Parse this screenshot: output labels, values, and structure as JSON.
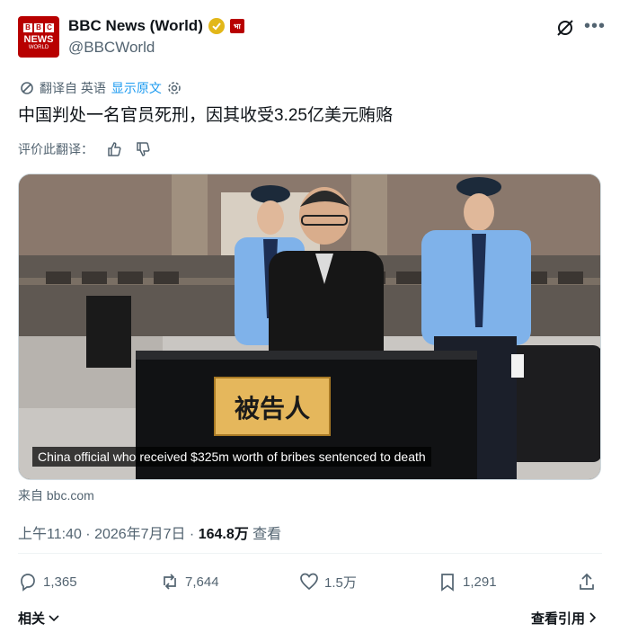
{
  "account": {
    "name": "BBC News (World)",
    "handle": "@BBCWorld",
    "avatar_text": [
      "B",
      "B",
      "C"
    ],
    "avatar_news": "NEWS",
    "avatar_world": "WORLD",
    "affiliation_badge": "भा"
  },
  "translation": {
    "translated_from": "翻译自 英语",
    "show_original": "显示原文"
  },
  "tweet": {
    "text": "中国判处一名官员死刑，因其收受3.25亿美元贿赂",
    "rate_translation": "评价此翻译："
  },
  "media": {
    "caption": "China official who received $325m worth of bribes sentenced to death",
    "podium_sign": "被告人",
    "source": "来自 bbc.com"
  },
  "meta": {
    "time": "上午11:40 · 2026年7月7日 · ",
    "views": "164.8万",
    "views_label": " 查看"
  },
  "actions": {
    "replies": "1,365",
    "reposts": "7,644",
    "likes": "1.5万",
    "bookmarks": "1,291"
  },
  "footer": {
    "related": "相关",
    "view_quotes": "查看引用"
  },
  "colors": {
    "brand_red": "#b80000",
    "link_blue": "#1d9bf0",
    "verified_gold": "#e2b719",
    "muted": "#536471"
  }
}
